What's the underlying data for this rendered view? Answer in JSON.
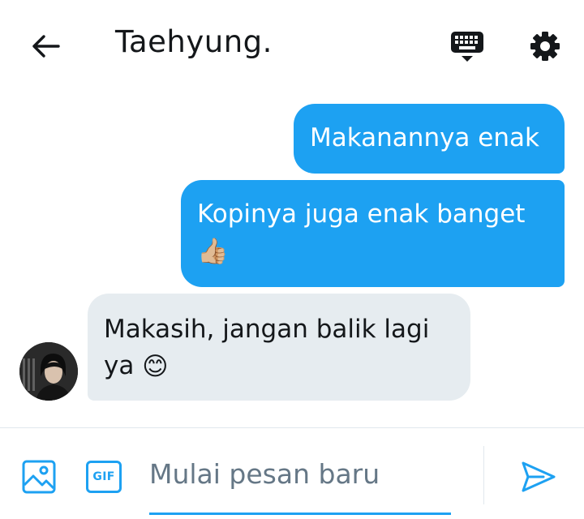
{
  "header": {
    "title": "Taehyung.",
    "back_icon": "arrow-left-icon",
    "keyboard_icon": "keyboard-icon",
    "settings_icon": "gear-icon"
  },
  "messages": [
    {
      "direction": "outgoing",
      "text": "Makanannya enak",
      "emoji": ""
    },
    {
      "direction": "outgoing",
      "text": "Kopinya juga enak banget",
      "emoji": "👍🏼"
    },
    {
      "direction": "incoming",
      "text": "Makasih, jangan balik lagi ya",
      "emoji": "😊"
    }
  ],
  "composer": {
    "placeholder": "Mulai pesan baru",
    "value": "",
    "gif_label": "GIF",
    "image_icon": "image-icon",
    "send_icon": "send-icon"
  },
  "colors": {
    "accent": "#1da1f2",
    "incoming_bubble": "#e6ecf0",
    "text": "#14171a",
    "placeholder": "#657786"
  }
}
